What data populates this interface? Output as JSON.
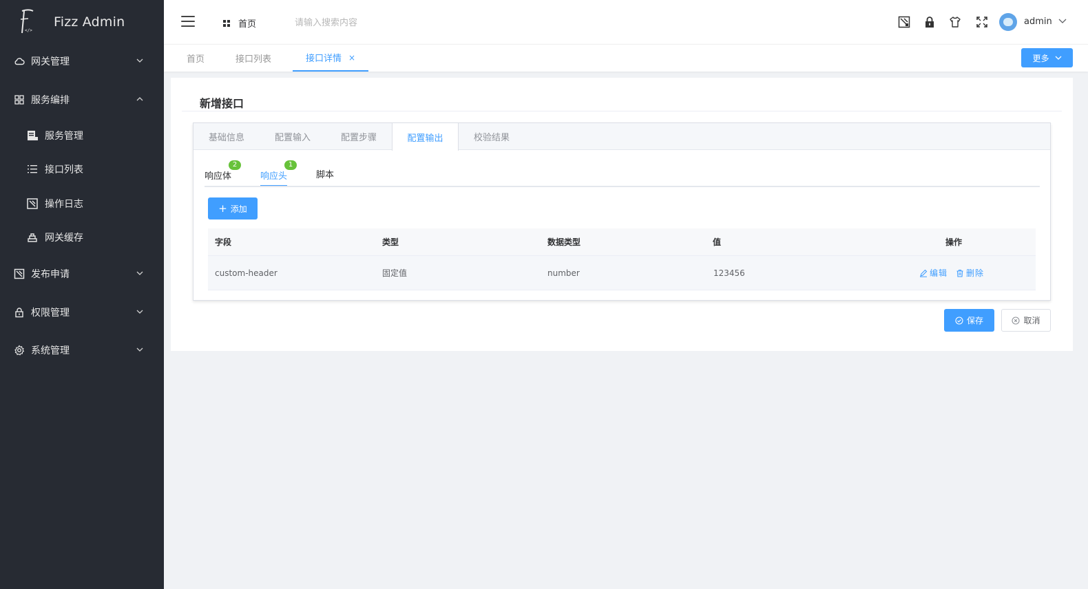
{
  "app": {
    "title": "Fizz Admin",
    "logo_caption": "</>"
  },
  "sidebar": {
    "menu": [
      {
        "label": "网关管理",
        "icon": "cloud-icon",
        "expanded": false
      },
      {
        "label": "服务编排",
        "icon": "grid-icon",
        "expanded": true
      },
      {
        "label": "发布申请",
        "icon": "publish-icon",
        "expanded": false
      },
      {
        "label": "权限管理",
        "icon": "lock-icon",
        "expanded": false
      },
      {
        "label": "系统管理",
        "icon": "gear-icon",
        "expanded": false
      }
    ],
    "submenu": [
      {
        "label": "服务管理",
        "icon": "server-icon"
      },
      {
        "label": "接口列表",
        "icon": "list-icon"
      },
      {
        "label": "操作日志",
        "icon": "log-icon"
      },
      {
        "label": "网关缓存",
        "icon": "cache-icon"
      }
    ]
  },
  "header": {
    "home_label": "首页",
    "search_placeholder": "请输入搜索内容",
    "username": "admin",
    "tools": [
      "screenshot-icon",
      "lock-icon",
      "shirt-icon",
      "fullscreen-icon"
    ]
  },
  "tabs": {
    "items": [
      {
        "label": "首页",
        "active": false
      },
      {
        "label": "接口列表",
        "active": false
      },
      {
        "label": "接口详情",
        "active": true,
        "closable": true
      }
    ],
    "close_glyph": "×",
    "more_label": "更多"
  },
  "form": {
    "title": "新增接口",
    "step_tabs": [
      "基础信息",
      "配置输入",
      "配置步骤",
      "配置输出",
      "校验结果"
    ],
    "active_step": "配置输出",
    "inner_tabs": [
      {
        "label": "响应体",
        "badge": "2",
        "active": false
      },
      {
        "label": "响应头",
        "badge": "1",
        "active": true
      },
      {
        "label": "脚本",
        "badge": "",
        "active": false
      }
    ],
    "add_label": "添加",
    "add_glyph": "+",
    "table": {
      "columns": [
        "字段",
        "类型",
        "数据类型",
        "值",
        "操作"
      ],
      "rows": [
        {
          "field": "custom-header",
          "type": "固定值",
          "data_type": "number",
          "value": "123456",
          "edit": "编辑",
          "delete": "删除"
        }
      ]
    },
    "save_label": "保存",
    "cancel_label": "取消"
  },
  "colors": {
    "sidebar_bg": "#272b33",
    "primary": "#409eff",
    "badge": "#67c23a",
    "page_bg": "#f0f2f5"
  }
}
